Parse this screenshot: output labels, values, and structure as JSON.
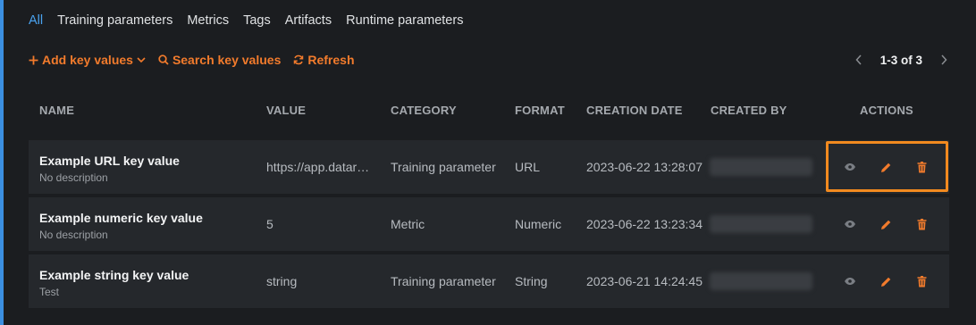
{
  "tabs": [
    {
      "label": "All",
      "active": true
    },
    {
      "label": "Training parameters"
    },
    {
      "label": "Metrics"
    },
    {
      "label": "Tags"
    },
    {
      "label": "Artifacts"
    },
    {
      "label": "Runtime parameters"
    }
  ],
  "toolbar": {
    "add_label": "Add key values",
    "search_label": "Search key values",
    "refresh_label": "Refresh"
  },
  "pagination": {
    "label": "1-3 of 3"
  },
  "table": {
    "headers": {
      "name": "NAME",
      "value": "VALUE",
      "category": "CATEGORY",
      "format": "FORMAT",
      "creation_date": "CREATION DATE",
      "created_by": "CREATED BY",
      "actions": "ACTIONS"
    },
    "rows": [
      {
        "name": "Example URL key value",
        "description": "No description",
        "value": "https://app.datar…",
        "category": "Training parameter",
        "format": "URL",
        "creation_date": "2023-06-22 13:28:07"
      },
      {
        "name": "Example numeric key value",
        "description": "No description",
        "value": "5",
        "category": "Metric",
        "format": "Numeric",
        "creation_date": "2023-06-22 13:23:34"
      },
      {
        "name": "Example string key value",
        "description": "Test",
        "value": "string",
        "category": "Training parameter",
        "format": "String",
        "creation_date": "2023-06-21 14:24:45"
      }
    ]
  },
  "colors": {
    "accent": "#f27b2c",
    "active_tab": "#4aa3f0",
    "highlight": "#f28a1f"
  },
  "icons": {
    "add": "plus-icon",
    "dropdown": "chevron-down-icon",
    "search": "search-icon",
    "refresh": "refresh-icon",
    "view": "eye-icon",
    "edit": "pencil-icon",
    "delete": "trash-icon"
  }
}
